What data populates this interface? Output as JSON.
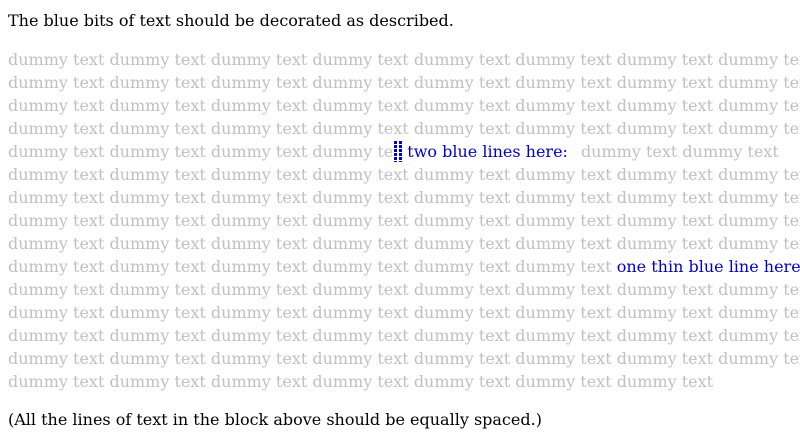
{
  "intro": "The blue bits of text should be decorated as described.",
  "dummy_full_line": "dummy text dummy text dummy text dummy text dummy text dummy text dummy text dummy text",
  "line5_before": "dummy text dummy text dummy text dummy te",
  "line5_blue": "two blue lines here:",
  "line5_after": "dummy text dummy text",
  "line10_before": "dummy text dummy text dummy text dummy text dummy text dummy text",
  "line10_blue": "one thin blue line here:",
  "last_line": "dummy text dummy text dummy text dummy text dummy text dummy text dummy text",
  "outro": "(All the lines of text in the block above should be equally spaced.)",
  "colors": {
    "dummy": "#c0c0c0",
    "blue": "#0000cc",
    "text": "#000000"
  }
}
